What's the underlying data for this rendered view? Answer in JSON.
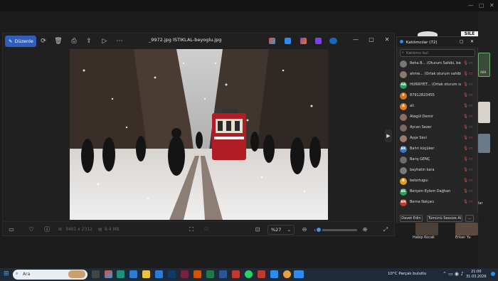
{
  "background": {
    "right_labels": [
      "SILE",
      "AKH",
      "lar"
    ],
    "videos": [
      {
        "name": "Habip Kocak"
      },
      {
        "name": "Erkan Yu"
      }
    ]
  },
  "photos": {
    "edit_label": "Düzenle",
    "file_title": "_9972.jpg ISTIKLAL-beyoglu.jpg",
    "dimensions": "3491 x 2312",
    "file_size": "8.4 MB",
    "zoom": "%27",
    "zoom_level": 0.1,
    "icons": {
      "edit": "edit-icon",
      "rotate": "rotate-icon",
      "delete": "trash-icon",
      "print": "print-icon",
      "share": "share-icon",
      "slideshow": "slideshow-icon",
      "more": "more-icon"
    }
  },
  "panel": {
    "title": "Katılımcılar (72)",
    "search_placeholder": "Katılımcı bul",
    "participants": [
      {
        "name": "Reha B... (Oturum Sahibi, ben)",
        "initials": "",
        "color": "#777777"
      },
      {
        "name": "ahme... (Ortak oturum sahibi)",
        "initials": "",
        "color": "#8a7a6a"
      },
      {
        "name": "HÜRRİYET... (Ortak oturum sahibi)",
        "initials": "HA",
        "color": "#2e9e5b"
      },
      {
        "name": "87912823455",
        "initials": "8",
        "color": "#d9731f"
      },
      {
        "name": "ali",
        "initials": "A",
        "color": "#e07b1f"
      },
      {
        "name": "Atagül Demir",
        "initials": "",
        "color": "#8d6e63"
      },
      {
        "name": "Aycan Sezer",
        "initials": "",
        "color": "#7a6a5a"
      },
      {
        "name": "Ayşe Sevi",
        "initials": "",
        "color": "#9a7b6b"
      },
      {
        "name": "Bahri küçüker",
        "initials": "BK",
        "color": "#3f74c9"
      },
      {
        "name": "Barış GENÇ",
        "initials": "",
        "color": "#6d6d6d"
      },
      {
        "name": "bayhatin kara",
        "initials": "",
        "color": "#7a7a7a"
      },
      {
        "name": "belortuguı",
        "initials": "B",
        "color": "#e0a11f"
      },
      {
        "name": "Berçem Eylem Dağhan",
        "initials": "BE",
        "color": "#2e9e5b"
      },
      {
        "name": "Berna Nalçacı",
        "initials": "BN",
        "color": "#c0392b"
      }
    ],
    "invite_label": "Davet Edin",
    "mute_all_label": "Tümünü Sessize Al",
    "more_label": "..."
  },
  "taskbar": {
    "search_placeholder": "Ara",
    "weather": "10°C Parçalı bulutlu",
    "time": "21:00",
    "date": "31.03.2026"
  }
}
